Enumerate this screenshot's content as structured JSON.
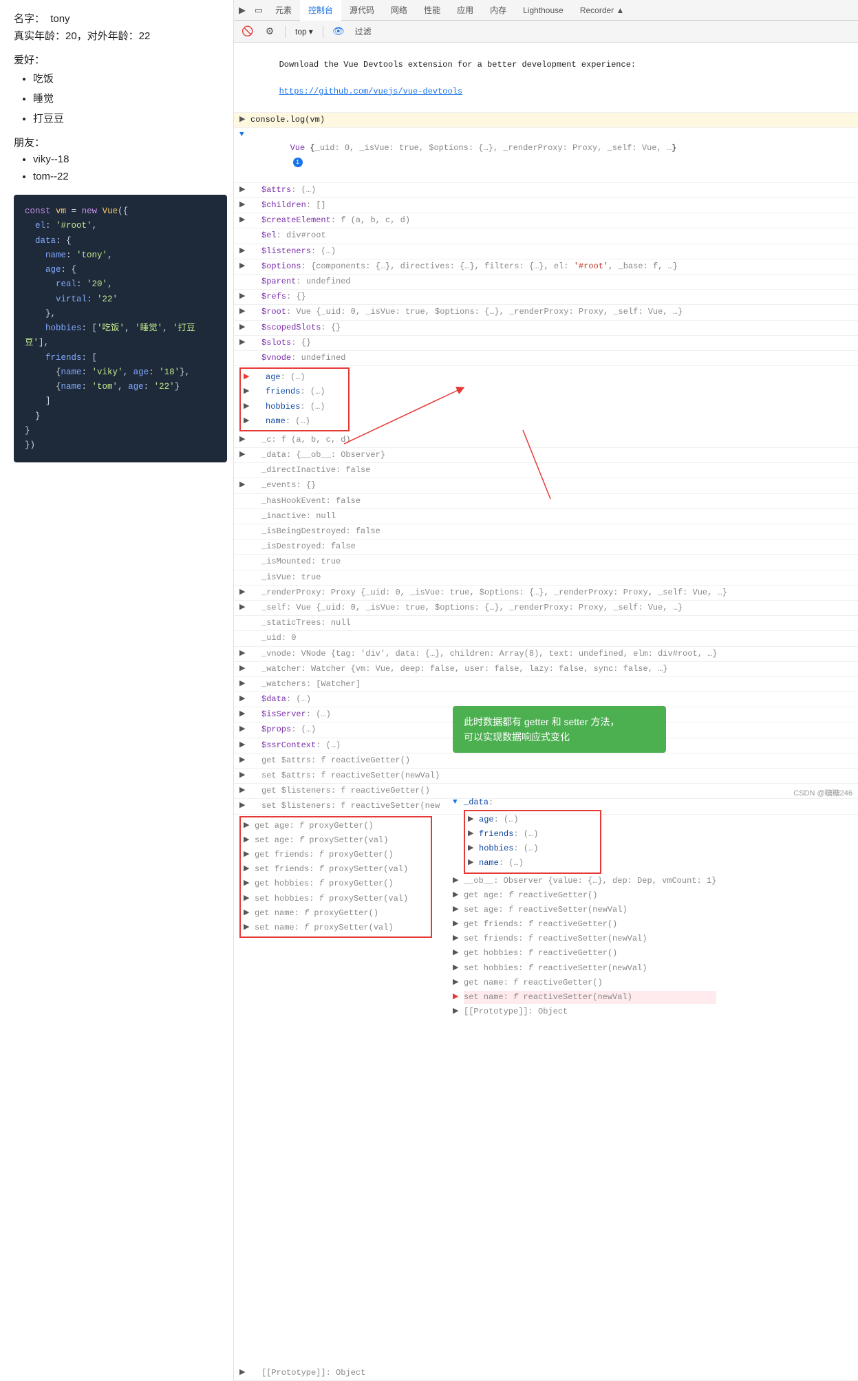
{
  "left": {
    "name_label": "名字：",
    "name_value": "tony",
    "age_line": "真实年龄：20，对外年龄：22",
    "hobbies_label": "爱好：",
    "hobbies": [
      "吃饭",
      "睡觉",
      "打豆豆"
    ],
    "friends_label": "朋友：",
    "friends": [
      "viky--18",
      "tom--22"
    ],
    "code": "const vm = new Vue({\n  el: '#root',\n  data: {\n    name: 'tony',\n    age: {\n      real: '20',\n      virtal: '22'\n    },\n    hobbies: ['吃饭', '睡觉', '打豆豆'],\n    friends: [\n      {name: 'viky', age: '18'},\n      {name: 'tom', age: '22'}\n    ]\n  }\n})"
  },
  "devtools": {
    "tabs_row1": [
      "元素",
      "控制台",
      "源代码",
      "网络",
      "性能",
      "应用",
      "内存",
      "Lighthouse",
      "Recorder ▲"
    ],
    "active_tab_row1": "控制台",
    "toolbar": {
      "level_label": "top",
      "filter_label": "过滤"
    },
    "info_message": "Download the Vue Devtools extension for a better development experience:",
    "info_link": "https://github.com/vuejs/vue-devtools",
    "console_log": "console.log(vm)",
    "annotation": {
      "text": "此时数据都有 getter 和 setter 方法，\n可以实现数据响应式变化"
    }
  }
}
